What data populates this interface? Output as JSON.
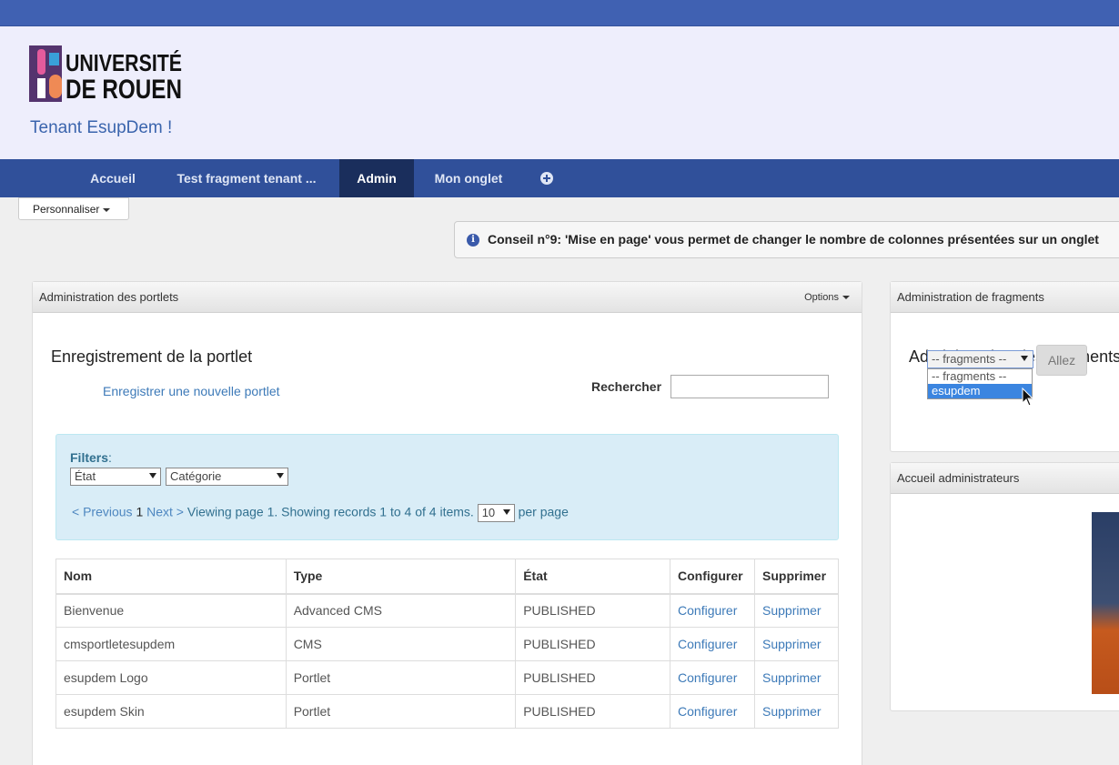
{
  "header": {
    "logo_text_1": "UNIVERSITÉ",
    "logo_text_2": "DE ROUEN",
    "tenant_title": "Tenant EsupDem !"
  },
  "nav": {
    "tabs": [
      {
        "label": "Accueil"
      },
      {
        "label": "Test fragment tenant ..."
      },
      {
        "label": "Admin"
      },
      {
        "label": "Mon onglet"
      }
    ],
    "active_tab": "Admin"
  },
  "customize_label": "Personnaliser",
  "tip": "Conseil n°9: 'Mise en page' vous permet de changer le nombre de colonnes présentées sur un onglet",
  "portlet_admin": {
    "header": "Administration des portlets",
    "options_label": "Options",
    "title": "Enregistrement de la portlet",
    "register_link": "Enregistrer une nouvelle portlet",
    "search_label": "Rechercher",
    "search_value": "",
    "filters_label": "Filters",
    "filter_state": "État",
    "filter_category": "Catégorie",
    "pager": {
      "previous": "< Previous",
      "current_page": "1",
      "next": "Next >",
      "summary": "Viewing page 1. Showing records 1 to 4 of 4 items.",
      "page_size": "10",
      "per_page": "per page"
    },
    "table": {
      "headers": [
        "Nom",
        "Type",
        "État",
        "Configurer",
        "Supprimer"
      ],
      "rows": [
        {
          "nom": "Bienvenue",
          "type": "Advanced CMS",
          "etat": "PUBLISHED",
          "configurer": "Configurer",
          "supprimer": "Supprimer"
        },
        {
          "nom": "cmsportletesupdem",
          "type": "CMS",
          "etat": "PUBLISHED",
          "configurer": "Configurer",
          "supprimer": "Supprimer"
        },
        {
          "nom": "esupdem Logo",
          "type": "Portlet",
          "etat": "PUBLISHED",
          "configurer": "Configurer",
          "supprimer": "Supprimer"
        },
        {
          "nom": "esupdem Skin",
          "type": "Portlet",
          "etat": "PUBLISHED",
          "configurer": "Configurer",
          "supprimer": "Supprimer"
        }
      ]
    }
  },
  "fragment_admin": {
    "header": "Administration de fragments",
    "title": "Administration des fragments",
    "select_value": "-- fragments --",
    "options": [
      "-- fragments --",
      "esupdem"
    ],
    "highlighted_option": "esupdem",
    "go_label": "Allez"
  },
  "admin_home": {
    "header": "Accueil administrateurs"
  },
  "colors": {
    "topbar": "#4061b2",
    "navbar": "#30509a",
    "nav_active": "#1a2e5c",
    "link": "#3d7ab8",
    "filters_bg": "#d9edf7",
    "selected_option": "#3b85e0"
  }
}
